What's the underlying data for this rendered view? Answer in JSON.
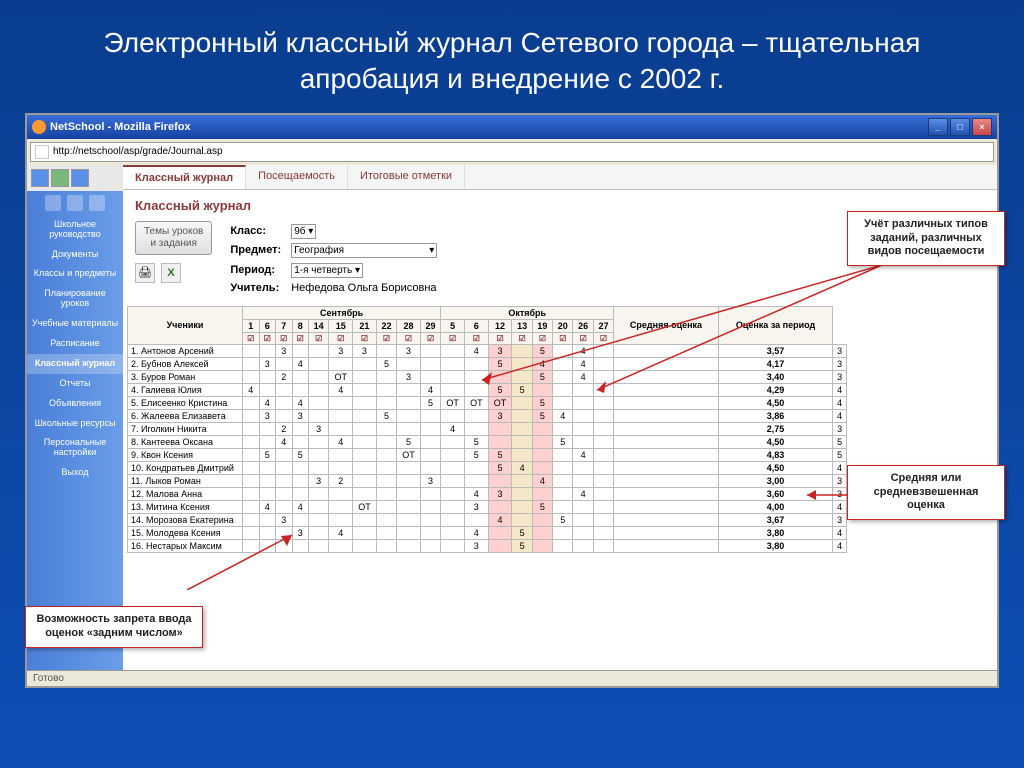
{
  "slide_title": "Электронный классный журнал Сетевого города – тщательная апробация и внедрение с 2002 г.",
  "window": {
    "title": "NetSchool - Mozilla Firefox",
    "url": "http://netschool/asp/grade/Journal.asp",
    "status": "Готово"
  },
  "tabs": [
    "Классный журнал",
    "Посещаемость",
    "Итоговые отметки"
  ],
  "page_title": "Классный журнал",
  "lesson_btn": "Темы уроков\nи задания",
  "form": {
    "class_lbl": "Класс:",
    "class_val": "9б",
    "subj_lbl": "Предмет:",
    "subj_val": "География",
    "period_lbl": "Период:",
    "period_val": "1-я четверть",
    "teacher_lbl": "Учитель:",
    "teacher_val": "Нефедова Ольга Борисовна"
  },
  "sidebar": [
    "Школьное руководство",
    "Документы",
    "Классы и предметы",
    "Планирование уроков",
    "Учебные материалы",
    "Расписание",
    "Классный журнал",
    "Отчеты",
    "Объявления",
    "Школьные ресурсы",
    "Персональные настройки",
    "Выход"
  ],
  "months": {
    "sep": "Сентябрь",
    "oct": "Октябрь"
  },
  "cols": {
    "students": "Ученики",
    "avg": "Средняя оценка",
    "period": "Оценка за период"
  },
  "sep_days": [
    "1",
    "6",
    "7",
    "8",
    "14",
    "15",
    "21",
    "22",
    "28",
    "29"
  ],
  "oct_days": [
    "5",
    "6",
    "12",
    "13",
    "19",
    "20",
    "26",
    "27"
  ],
  "students": [
    {
      "n": "1",
      "name": "Антонов Арсений",
      "g": [
        "",
        "",
        "3",
        "",
        "",
        "3",
        "3",
        "",
        "3",
        "",
        "",
        "4",
        "3",
        "",
        "5",
        "",
        "4",
        "",
        ""
      ],
      "avg": "3,57",
      "p": "3"
    },
    {
      "n": "2",
      "name": "Бубнов Алексей",
      "g": [
        "",
        "3",
        "",
        "4",
        "",
        "",
        "",
        "5",
        "",
        "",
        "",
        "",
        "5",
        "",
        "4",
        "",
        "4",
        "",
        ""
      ],
      "avg": "4,17",
      "p": "3"
    },
    {
      "n": "3",
      "name": "Буров Роман",
      "g": [
        "",
        "",
        "2",
        "",
        "",
        "ОТ",
        "",
        "",
        "3",
        "",
        "",
        "",
        "",
        "",
        "5",
        "",
        "4",
        "",
        ""
      ],
      "avg": "3,40",
      "p": "3"
    },
    {
      "n": "4",
      "name": "Галиева Юлия",
      "g": [
        "4",
        "",
        "",
        "",
        "",
        "4",
        "",
        "",
        "",
        "4",
        "",
        "",
        "5",
        "5",
        "",
        "",
        "",
        "",
        ""
      ],
      "avg": "4,29",
      "p": "4"
    },
    {
      "n": "5",
      "name": "Елисеенко Кристина",
      "g": [
        "",
        "4",
        "",
        "4",
        "",
        "",
        "",
        "",
        "",
        "5",
        "ОТ",
        "ОТ",
        "ОТ",
        "",
        "5",
        "",
        "",
        "",
        ""
      ],
      "avg": "4,50",
      "p": "4"
    },
    {
      "n": "6",
      "name": "Жалеева Елизавета",
      "g": [
        "",
        "3",
        "",
        "3",
        "",
        "",
        "",
        "5",
        "",
        "",
        "",
        "",
        "3",
        "",
        "5",
        "4",
        "",
        "",
        ""
      ],
      "avg": "3,86",
      "p": "4"
    },
    {
      "n": "7",
      "name": "Иголкин Никита",
      "g": [
        "",
        "",
        "2",
        "",
        "3",
        "",
        "",
        "",
        "",
        "",
        "4",
        "",
        "",
        "",
        "",
        "",
        "",
        "",
        ""
      ],
      "avg": "2,75",
      "p": "3"
    },
    {
      "n": "8",
      "name": "Кантеева Оксана",
      "g": [
        "",
        "",
        "4",
        "",
        "",
        "4",
        "",
        "",
        "5",
        "",
        "",
        "5",
        "",
        "",
        "",
        "5",
        "",
        "",
        ""
      ],
      "avg": "4,50",
      "p": "5"
    },
    {
      "n": "9",
      "name": "Квон Ксения",
      "g": [
        "",
        "5",
        "",
        "5",
        "",
        "",
        "",
        "",
        "ОТ",
        "",
        "",
        "5",
        "5",
        "",
        "",
        "",
        "4",
        "",
        ""
      ],
      "avg": "4,83",
      "p": "5"
    },
    {
      "n": "10",
      "name": "Кондратьев Дмитрий",
      "g": [
        "",
        "",
        "",
        "",
        "",
        "",
        "",
        "",
        "",
        "",
        "",
        "",
        "5",
        "4",
        "",
        "",
        "",
        "",
        ""
      ],
      "avg": "4,50",
      "p": "4"
    },
    {
      "n": "11",
      "name": "Лыков Роман",
      "g": [
        "",
        "",
        "",
        "",
        "3",
        "2",
        "",
        "",
        "",
        "3",
        "",
        "",
        "",
        "",
        "4",
        "",
        "",
        "",
        ""
      ],
      "avg": "3,00",
      "p": "3"
    },
    {
      "n": "12",
      "name": "Малова Анна",
      "g": [
        "",
        "",
        "",
        "",
        "",
        "",
        "",
        "",
        "",
        "",
        "",
        "4",
        "3",
        "",
        "",
        "",
        "4",
        "",
        ""
      ],
      "avg": "3,60",
      "p": "3"
    },
    {
      "n": "13",
      "name": "Митина Ксения",
      "g": [
        "",
        "4",
        "",
        "4",
        "",
        "",
        "ОТ",
        "",
        "",
        "",
        "",
        "3",
        "",
        "",
        "5",
        "",
        "",
        "",
        ""
      ],
      "avg": "4,00",
      "p": "4"
    },
    {
      "n": "14",
      "name": "Морозова Екатерина",
      "g": [
        "",
        "",
        "3",
        "",
        "",
        "",
        "",
        "",
        "",
        "",
        "",
        "",
        "4",
        "",
        "",
        "5",
        "",
        "",
        ""
      ],
      "avg": "3,67",
      "p": "3"
    },
    {
      "n": "15",
      "name": "Молодева Ксения",
      "g": [
        "",
        "",
        "",
        "3",
        "",
        "4",
        "",
        "",
        "",
        "",
        "",
        "4",
        "",
        "5",
        "",
        "",
        "",
        "",
        ""
      ],
      "avg": "3,80",
      "p": "4"
    },
    {
      "n": "16",
      "name": "Нестарых Максим",
      "g": [
        "",
        "",
        "",
        "",
        "",
        "",
        "",
        "",
        "",
        "",
        "",
        "3",
        "",
        "5",
        "",
        "",
        "",
        "",
        ""
      ],
      "avg": "3,80",
      "p": "4"
    }
  ],
  "callouts": {
    "top_right": "Учёт различных типов заданий, различных видов посещаемости",
    "right": "Средняя или средневзвешенная оценка",
    "bottom_left": "Возможность запрета ввода оценок «задним числом»"
  }
}
